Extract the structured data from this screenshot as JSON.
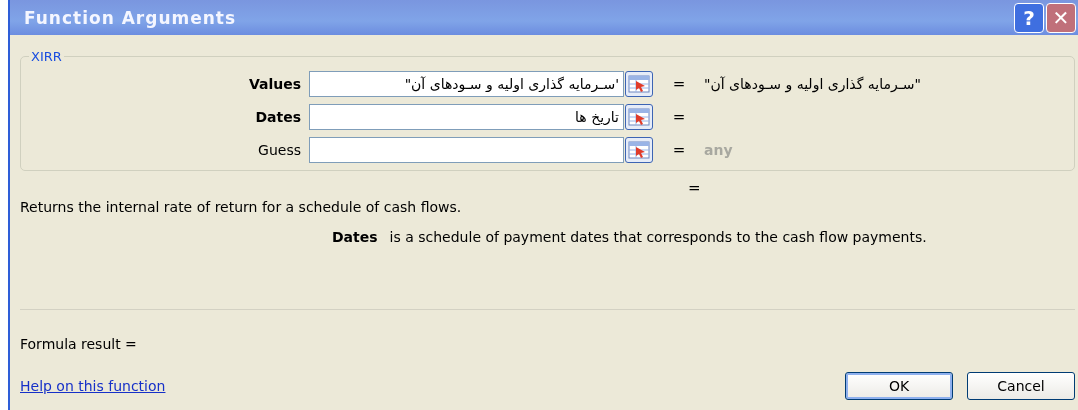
{
  "window": {
    "title": "Function Arguments",
    "buttons": [
      "?",
      "✕"
    ]
  },
  "function_name": "XIRR",
  "arguments": [
    {
      "label": "Values",
      "required": true,
      "value": "'سـرمایه گذاری اولیه و سـودهای آن\"",
      "result": "\"سـرمایه گذاری اولیه و سـودهای آن\"",
      "result_muted": false,
      "equals": "="
    },
    {
      "label": "Dates",
      "required": true,
      "value": "تاریخ ها",
      "equals": "="
    },
    {
      "label": "Guess",
      "required": false,
      "result": "any",
      "result_muted": true,
      "equals": "="
    }
  ],
  "total_equals": "=",
  "description": "Returns the internal rate of return for a schedule of cash flows.",
  "argument_help": {
    "name": "Dates",
    "text": "is a schedule of payment dates that corresponds to the cash flow payments."
  },
  "formula_result": "Formula result =",
  "help_link": "Help on this function",
  "buttons": [
    {
      "label": "OK",
      "default": true
    },
    {
      "label": "Cancel",
      "default": false
    }
  ]
}
